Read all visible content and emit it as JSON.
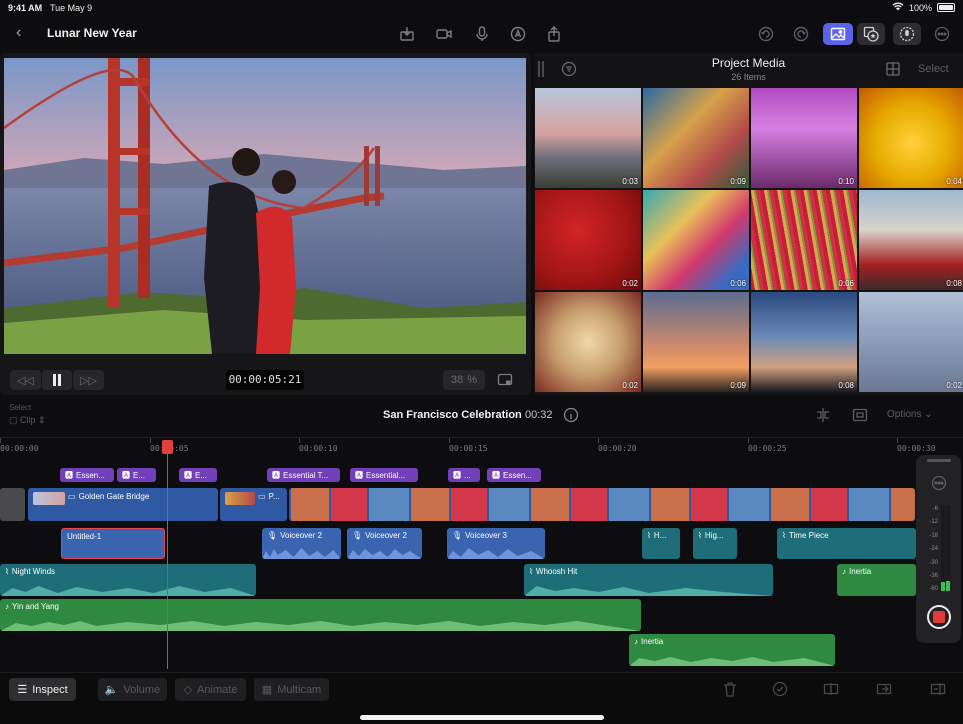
{
  "status": {
    "time": "9:41 AM",
    "date": "Tue May 9",
    "battery": "100%"
  },
  "header": {
    "title": "Lunar New Year"
  },
  "viewer": {
    "timecode": "00:00:05:21",
    "zoom": "38",
    "zoom_unit": "%"
  },
  "media": {
    "title": "Project Media",
    "count": "26 Items",
    "select_label": "Select",
    "thumbnails": [
      {
        "duration": "0:03"
      },
      {
        "duration": "0:09"
      },
      {
        "duration": "0:10"
      },
      {
        "duration": "0:04"
      },
      {
        "duration": "0:02"
      },
      {
        "duration": "0:06"
      },
      {
        "duration": "0:06"
      },
      {
        "duration": "0:08"
      },
      {
        "duration": "0:02"
      },
      {
        "duration": "0:09"
      },
      {
        "duration": "0:08"
      },
      {
        "duration": "0:02"
      }
    ]
  },
  "timeline": {
    "title": "San Francisco Celebration",
    "duration": "00:32",
    "select_label": "Select",
    "clip_label": "Clip",
    "options_label": "Options",
    "ruler": [
      "00:00:00",
      "00:00:05",
      "00:00:10",
      "00:00:15",
      "00:00:20",
      "00:00:25",
      "00:00:30"
    ],
    "titles": [
      "Essen...",
      "E...",
      "E...",
      "Essential T...",
      "Essential...",
      "...",
      "Essen..."
    ],
    "primary_clip": "Golden Gate Bridge",
    "secondary_clip": "P...",
    "voice": [
      "Untitled-1",
      "Voiceover 2",
      "Voiceover 2",
      "Voiceover 3",
      "H...",
      "Hig...",
      "Time Piece"
    ],
    "effects": [
      "Night Winds",
      "Whoosh Hit",
      "Inertia"
    ],
    "music": [
      "Yin and Yang",
      "Inertia"
    ]
  },
  "meter": {
    "scale": [
      "-6",
      "-12",
      "-18",
      "-24",
      "-30",
      "-36",
      "-60"
    ],
    "level_left": 0.1,
    "level_right": 0.12
  },
  "toolbar": {
    "inspect": "Inspect",
    "volume": "Volume",
    "animate": "Animate",
    "multicam": "Multicam"
  },
  "colors": {
    "accent": "#5b63e8",
    "playhead": "#e04040",
    "title_clip": "#7140b8",
    "video_clip": "#2f5aa3",
    "audio_teal": "#1d6e78",
    "audio_green": "#2d8a40"
  }
}
